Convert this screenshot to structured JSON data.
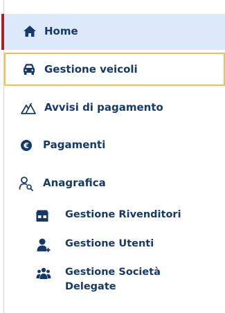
{
  "sidebar": {
    "colors": {
      "text": "#143a6b",
      "active_bg": "#dce9fb",
      "active_bar": "#b02029",
      "focus_border": "#f3c049"
    },
    "items": [
      {
        "label": "Home",
        "icon": "home-icon",
        "active": true
      },
      {
        "label": "Gestione veicoli",
        "icon": "car-icon",
        "focused": true
      },
      {
        "label": "Avvisi di pagamento",
        "icon": "mountain-icon"
      },
      {
        "label": "Pagamenti",
        "icon": "euro-coin-icon"
      },
      {
        "label": "Anagrafica",
        "icon": "user-search-icon",
        "children": [
          {
            "label": "Gestione Rivenditori",
            "icon": "store-icon"
          },
          {
            "label": "Gestione Utenti",
            "icon": "user-add-icon"
          },
          {
            "label": "Gestione Società Delegate",
            "icon": "users-group-icon"
          }
        ]
      }
    ]
  }
}
